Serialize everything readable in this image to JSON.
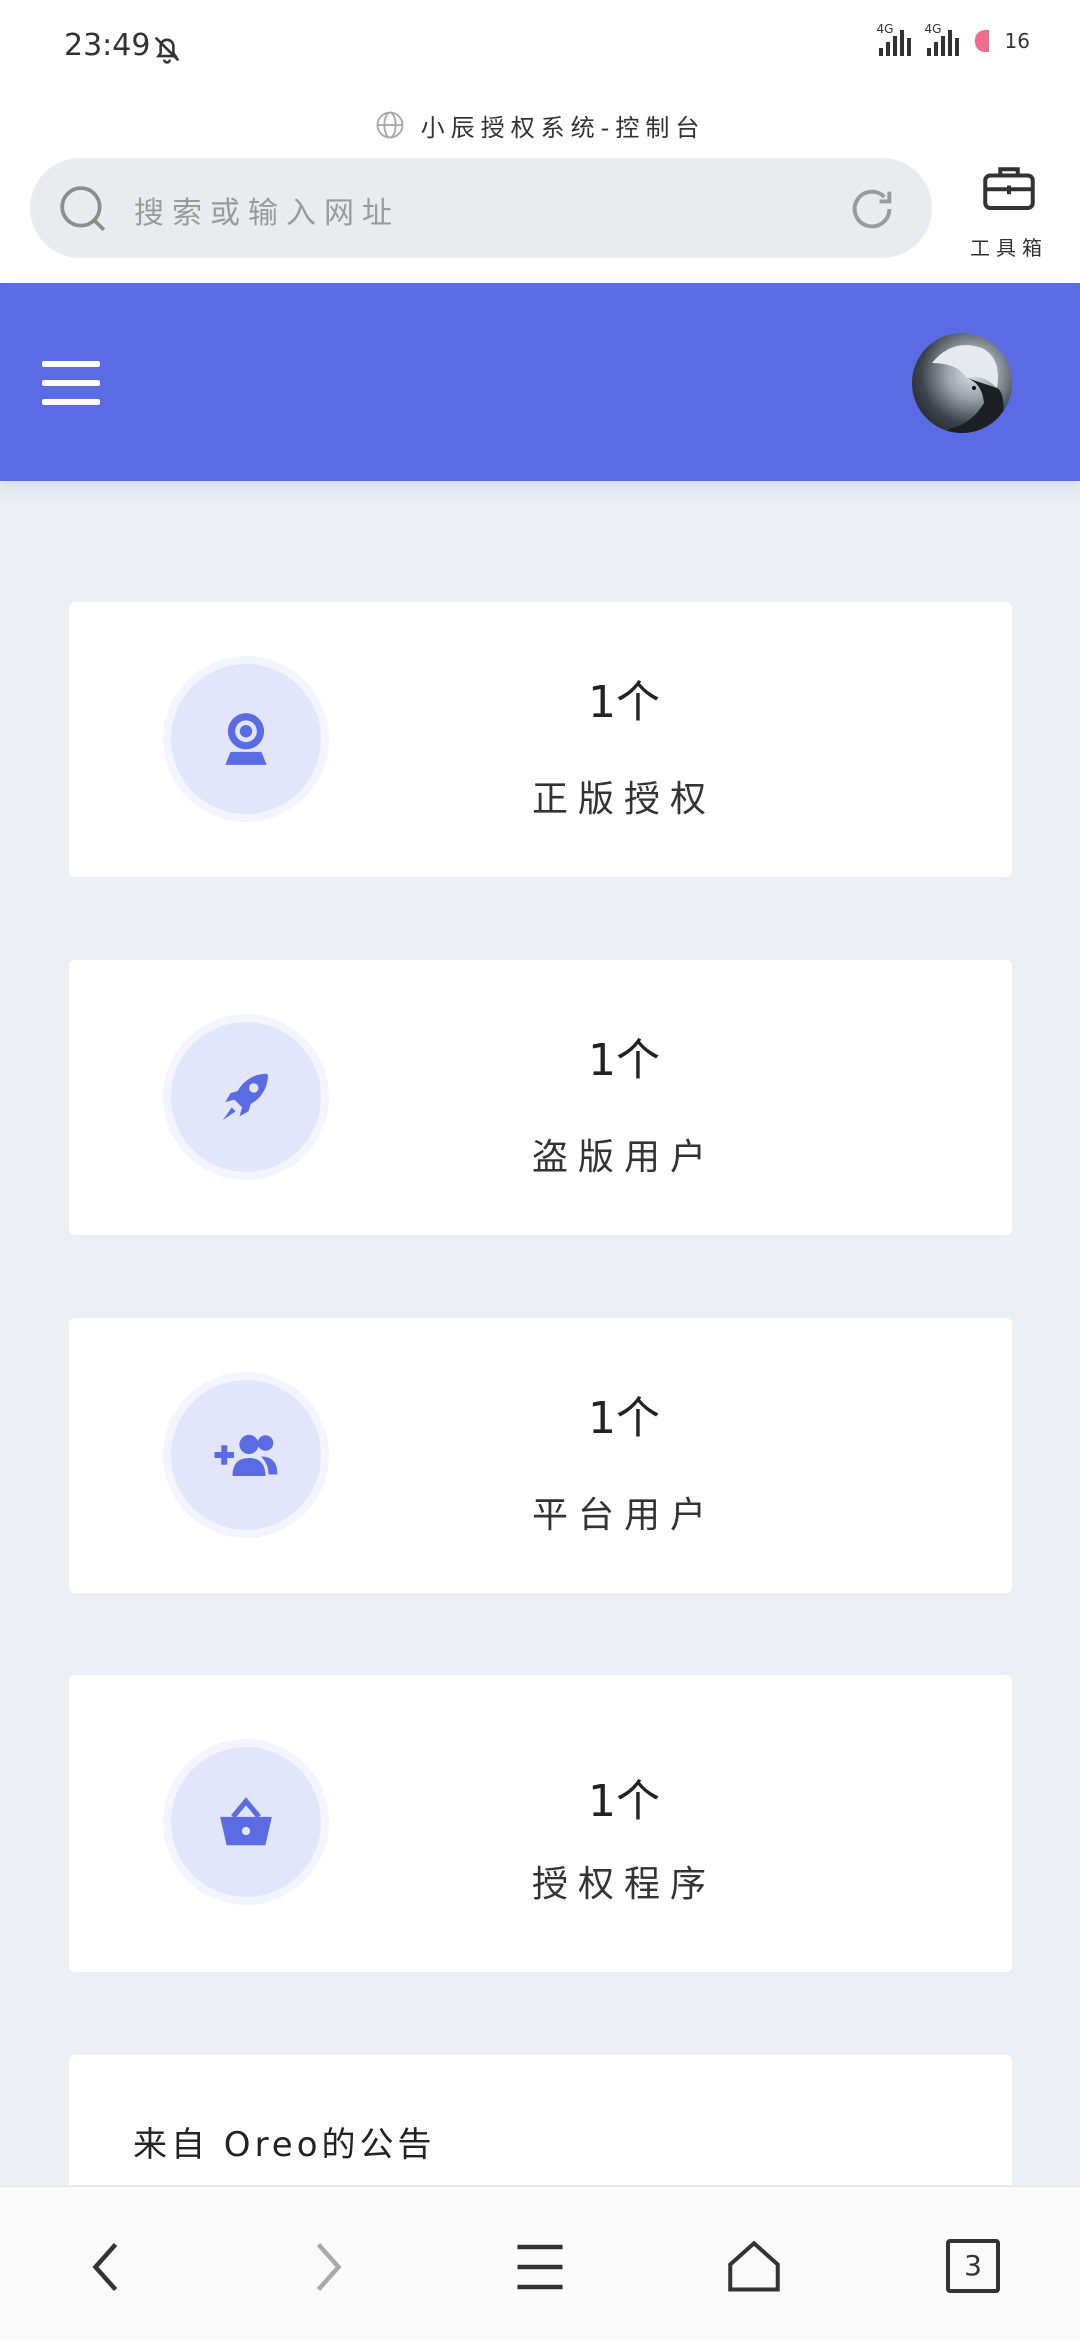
{
  "status_bar": {
    "time": "23:49",
    "network_1": "4G",
    "network_2": "4G",
    "battery": "16"
  },
  "browser": {
    "page_title": "小辰授权系统-控制台",
    "address_placeholder": "搜索或输入网址",
    "toolbox_label": "工具箱",
    "tab_count": "3"
  },
  "stats": [
    {
      "count": "1个",
      "label": "正版授权",
      "icon": "webcam-icon"
    },
    {
      "count": "1个",
      "label": "盗版用户",
      "icon": "rocket-icon"
    },
    {
      "count": "1个",
      "label": "平台用户",
      "icon": "user-plus-icon"
    },
    {
      "count": "1个",
      "label": "授权程序",
      "icon": "basket-icon"
    }
  ],
  "notice": {
    "title": "来自 Oreo的公告"
  },
  "colors": {
    "primary": "#5a6be3",
    "icon_bg": "#e3e5fb",
    "page_bg": "#ebeef3"
  }
}
